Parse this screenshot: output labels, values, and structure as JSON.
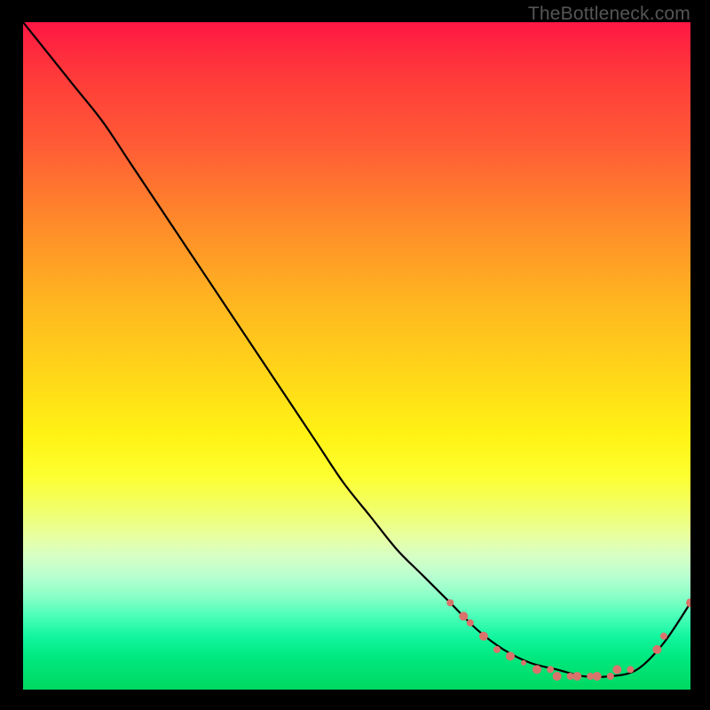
{
  "attribution": "TheBottleneck.com",
  "chart_data": {
    "type": "line",
    "title": "",
    "xlabel": "",
    "ylabel": "",
    "xlim": [
      0,
      100
    ],
    "ylim": [
      0,
      100
    ],
    "gradient_stops": [
      {
        "pos": 0,
        "color": "#ff1744"
      },
      {
        "pos": 50,
        "color": "#ffd400"
      },
      {
        "pos": 75,
        "color": "#f5ff60"
      },
      {
        "pos": 100,
        "color": "#00d860"
      }
    ],
    "series": [
      {
        "name": "bottleneck-curve",
        "x": [
          0,
          4,
          8,
          12,
          16,
          20,
          24,
          28,
          32,
          36,
          40,
          44,
          48,
          52,
          56,
          60,
          64,
          68,
          72,
          76,
          80,
          84,
          88,
          92,
          96,
          100
        ],
        "y": [
          100,
          95,
          90,
          85,
          79,
          73,
          67,
          61,
          55,
          49,
          43,
          37,
          31,
          26,
          21,
          17,
          13,
          9,
          6,
          4,
          3,
          2,
          2,
          3,
          7,
          13
        ]
      }
    ],
    "markers": {
      "name": "highlight-points",
      "color": "#d9736b",
      "points": [
        {
          "x": 64,
          "y": 13,
          "r": 4
        },
        {
          "x": 66,
          "y": 11,
          "r": 5
        },
        {
          "x": 67,
          "y": 10,
          "r": 4
        },
        {
          "x": 69,
          "y": 8,
          "r": 5
        },
        {
          "x": 71,
          "y": 6,
          "r": 4
        },
        {
          "x": 73,
          "y": 5,
          "r": 5
        },
        {
          "x": 75,
          "y": 4,
          "r": 3
        },
        {
          "x": 77,
          "y": 3,
          "r": 5
        },
        {
          "x": 79,
          "y": 3,
          "r": 4
        },
        {
          "x": 80,
          "y": 2,
          "r": 5
        },
        {
          "x": 82,
          "y": 2,
          "r": 4
        },
        {
          "x": 83,
          "y": 2,
          "r": 5
        },
        {
          "x": 85,
          "y": 2,
          "r": 4
        },
        {
          "x": 86,
          "y": 2,
          "r": 5
        },
        {
          "x": 88,
          "y": 2,
          "r": 4
        },
        {
          "x": 89,
          "y": 3,
          "r": 5
        },
        {
          "x": 91,
          "y": 3,
          "r": 4
        },
        {
          "x": 95,
          "y": 6,
          "r": 5
        },
        {
          "x": 96,
          "y": 8,
          "r": 4
        },
        {
          "x": 100,
          "y": 13,
          "r": 5
        }
      ]
    }
  }
}
